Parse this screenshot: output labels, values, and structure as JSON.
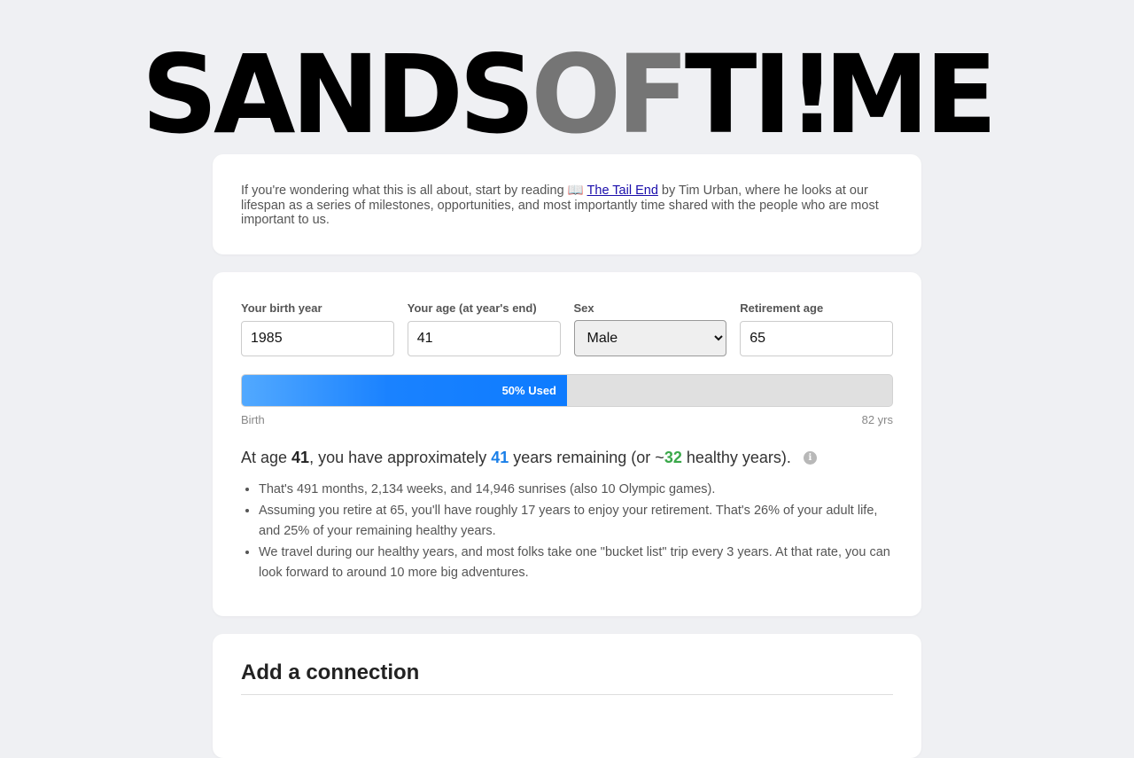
{
  "logo": {
    "part1": "SANDS",
    "part2": "OF",
    "part3": "TI",
    "part4": "!",
    "part5": "ME"
  },
  "intro": {
    "before": "If you're wondering what this is all about, start by reading ",
    "book_icon": "📖",
    "link_text": "The Tail End",
    "after": " by Tim Urban, where he looks at our lifespan as a series of milestones, opportunities, and most importantly time shared with the people who are most important to us."
  },
  "form": {
    "birth_year_label": "Your birth year",
    "birth_year_value": "1985",
    "age_label": "Your age (at year's end)",
    "age_value": "41",
    "sex_label": "Sex",
    "sex_value": "Male",
    "retirement_label": "Retirement age",
    "retirement_value": "65"
  },
  "progress": {
    "percent": 50,
    "label": "50% Used",
    "start_label": "Birth",
    "end_label": "82 yrs"
  },
  "summary": {
    "t1": "At age ",
    "age": "41",
    "t2": ", you have approximately ",
    "years": "41",
    "t3": " years remaining (or ~",
    "healthy": "32",
    "t4": " healthy years).",
    "info_icon": "i"
  },
  "facts": [
    "That's 491 months, 2,134 weeks, and 14,946 sunrises (also 10 Olympic games).",
    "Assuming you retire at 65, you'll have roughly 17 years to enjoy your retirement. That's 26% of your adult life, and 25% of your remaining healthy years.",
    "We travel during our healthy years, and most folks take one \"bucket list\" trip every 3 years. At that rate, you can look forward to around 10 more big adventures."
  ],
  "connection": {
    "title": "Add a connection"
  }
}
